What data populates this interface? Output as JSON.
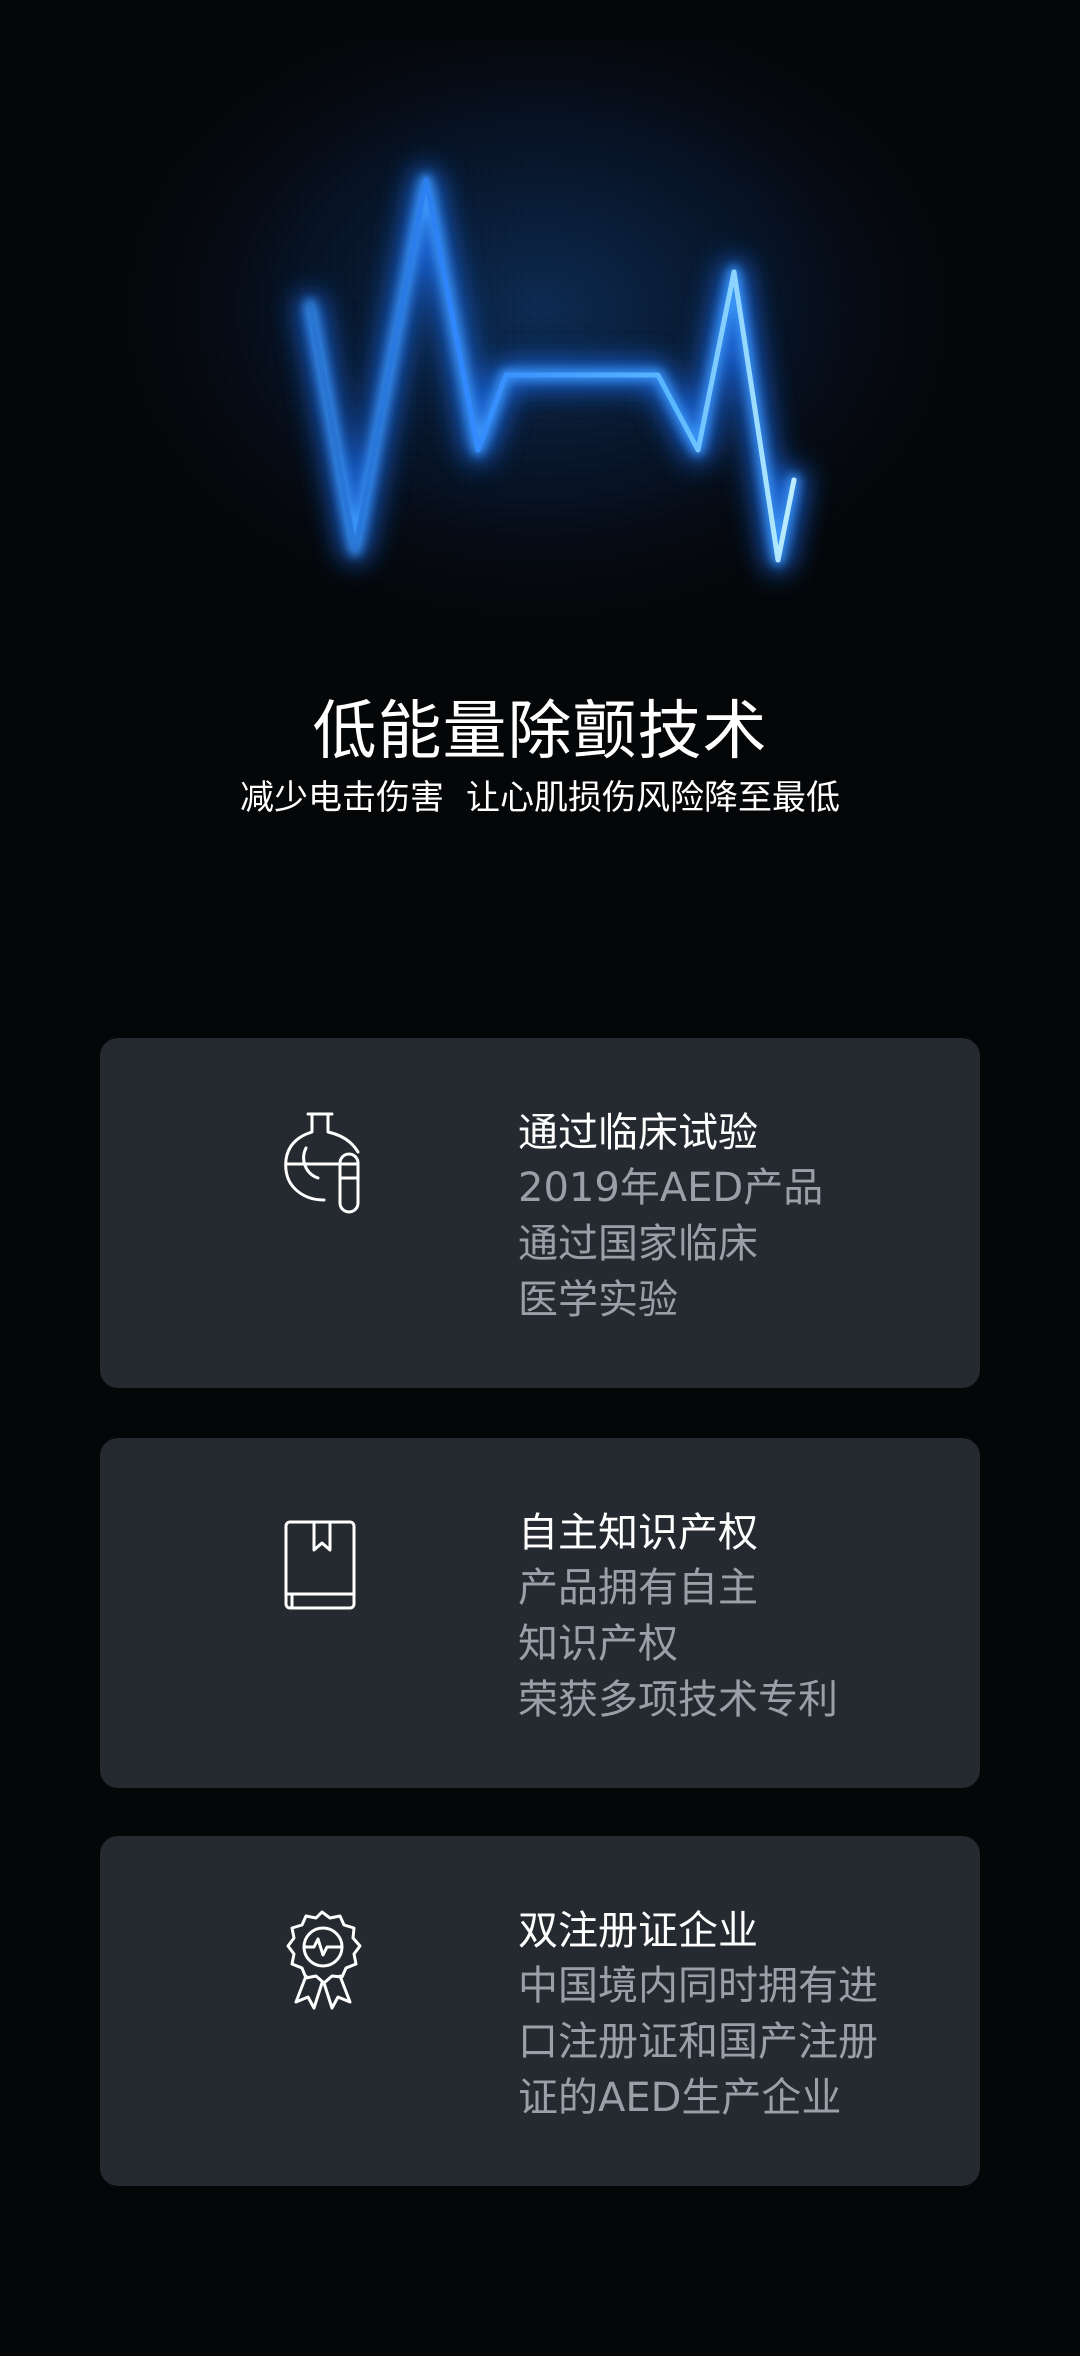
{
  "hero": {
    "title": "低能量除颤技术",
    "subtitle_part1": "减少电击伤害",
    "subtitle_part2": "让心肌损伤风险降至最低"
  },
  "cards": [
    {
      "icon": "lab-flask-icon",
      "title": "通过临床试验",
      "lines": [
        "2019年AED产品",
        "通过国家临床",
        "医学实验"
      ]
    },
    {
      "icon": "book-bookmark-icon",
      "title": "自主知识产权",
      "lines": [
        "产品拥有自主",
        "知识产权",
        "荣获多项技术专利"
      ]
    },
    {
      "icon": "certified-badge-icon",
      "title": "双注册证企业",
      "lines": [
        "中国境内同时拥有进",
        "口注册证和国产注册",
        "证的AED生产企业"
      ]
    }
  ],
  "colors": {
    "background": "#050608",
    "card": "#252a30",
    "title_text": "#ffffff",
    "desc_text": "#9aa0a7",
    "glow": "#2f8fff"
  }
}
